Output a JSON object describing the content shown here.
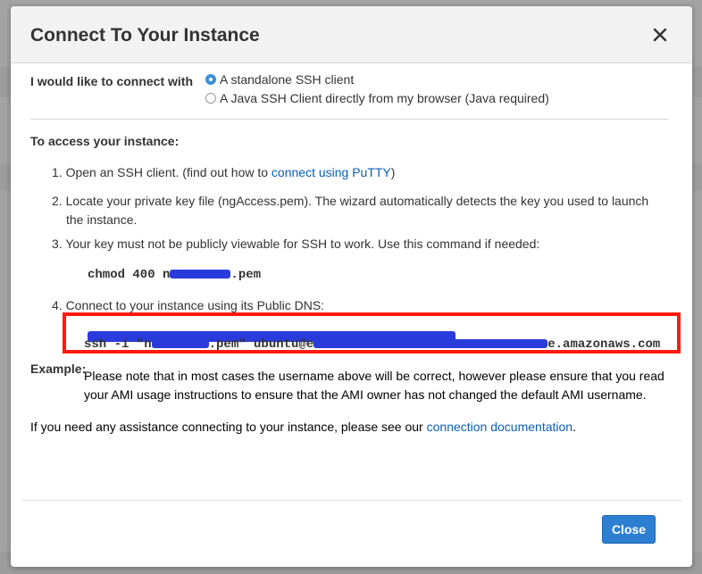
{
  "modal": {
    "title": "Connect To Your Instance",
    "close_icon": "close-icon"
  },
  "connect_with": {
    "label": "I would like to connect with",
    "options": [
      {
        "label": "A standalone SSH client",
        "selected": true
      },
      {
        "label": "A Java SSH Client directly from my browser (Java required)",
        "selected": false
      }
    ]
  },
  "access": {
    "heading": "To access your instance:",
    "step1_prefix": "1. Open an SSH client. (find out how to ",
    "step1_link": "connect using PuTTY",
    "step1_suffix": ")",
    "step2_line1": "2. Locate your private key file (ngAccess.pem). The wizard automatically detects the key you used to launch",
    "step2_line2": "the instance.",
    "step3": "3. Your key must not be publicly viewable for SSH to work. Use this command if needed:",
    "chmod_prefix": "chmod 400 n",
    "chmod_suffix": ".pem",
    "step4": "4. Connect to your instance using its Public DNS:"
  },
  "example": {
    "heading": "Example:",
    "cmd_part1": "ssh -i \"n",
    "cmd_part2": ".pem\" ubuntu@e",
    "cmd_part3": "e.amazonaws.com",
    "note_line1": "Please note that in most cases the username above will be correct, however please ensure that you read",
    "note_line2": "your AMI usage instructions to ensure that the AMI owner has not changed the default AMI username."
  },
  "assist": {
    "prefix": "If you need any assistance connecting to your instance, please see our ",
    "link": "connection documentation",
    "suffix": "."
  },
  "footer": {
    "close_label": "Close"
  },
  "colors": {
    "accent": "#2d7fd2",
    "link": "#0a5eb8",
    "highlight": "#ff1a0e",
    "redaction": "#2a3bdc"
  }
}
